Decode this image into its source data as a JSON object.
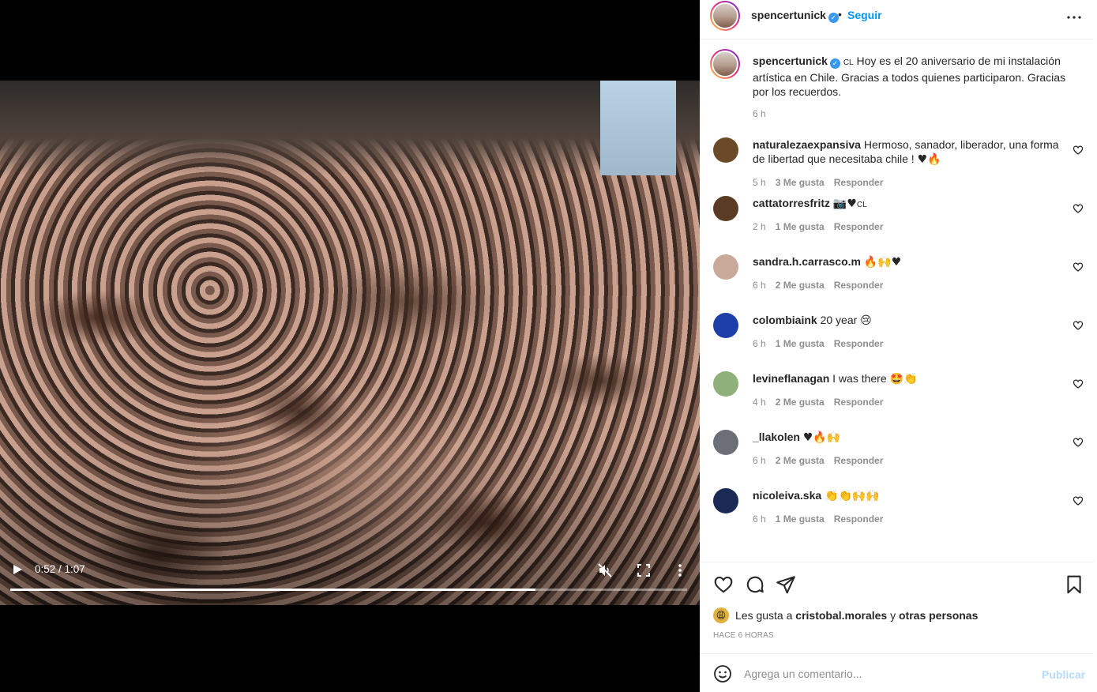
{
  "video": {
    "time_current": "0:52 / 1:07",
    "progress_fraction": 0.776
  },
  "post": {
    "username": "spencertunick",
    "dot": "•",
    "follow_label": "Seguir",
    "caption_flag": "CL",
    "caption_text": "Hoy es el 20 aniversario de mi instalación artística en Chile. Gracias a todos quienes participaron. Gracias por los recuerdos.",
    "caption_time": "6 h"
  },
  "comments": [
    {
      "user": "naturalezaexpansiva",
      "text": "Hermoso, sanador, liberador, una forma de libertad que necesitaba chile !",
      "emoji": "♥🔥",
      "time": "5 h",
      "likes": "3 Me gusta",
      "reply": "Responder",
      "avatar_color": "#6b4a2a"
    },
    {
      "user": "cattatorresfritz",
      "text": "",
      "emoji": "📷♥",
      "flag": "CL",
      "time": "2 h",
      "likes": "1 Me gusta",
      "reply": "Responder",
      "avatar_color": "#5a3b25"
    },
    {
      "user": "sandra.h.carrasco.m",
      "text": "",
      "emoji": "🔥🙌♥",
      "time": "6 h",
      "likes": "2 Me gusta",
      "reply": "Responder",
      "avatar_color": "#c9a99a"
    },
    {
      "user": "colombiaink",
      "text": "20 year",
      "emoji": "😢",
      "time": "6 h",
      "likes": "1 Me gusta",
      "reply": "Responder",
      "avatar_color": "#1f3fa8"
    },
    {
      "user": "levineflanagan",
      "text": "I was there",
      "emoji": "🤩👏",
      "time": "4 h",
      "likes": "2 Me gusta",
      "reply": "Responder",
      "avatar_color": "#8fb07a"
    },
    {
      "user": "_llakolen",
      "text": "",
      "emoji": "♥🔥🙌",
      "time": "6 h",
      "likes": "2 Me gusta",
      "reply": "Responder",
      "avatar_color": "#6d6f78"
    },
    {
      "user": "nicoleiva.ska",
      "text": "",
      "emoji": "👏👏🙌🙌",
      "time": "6 h",
      "likes": "1 Me gusta",
      "reply": "Responder",
      "avatar_color": "#1a2a55"
    }
  ],
  "likes": {
    "prefix": "Les gusta a",
    "user": "cristobal.morales",
    "connector": "y",
    "others": "otras personas"
  },
  "posted_time": "HACE 6 HORAS",
  "add_comment": {
    "placeholder": "Agrega un comentario...",
    "publish_label": "Publicar"
  },
  "colors": {
    "link": "#0095f6",
    "publish_disabled": "#b3dbff",
    "meta_gray": "#8e8e8e",
    "heart_red": "#ed4956"
  }
}
